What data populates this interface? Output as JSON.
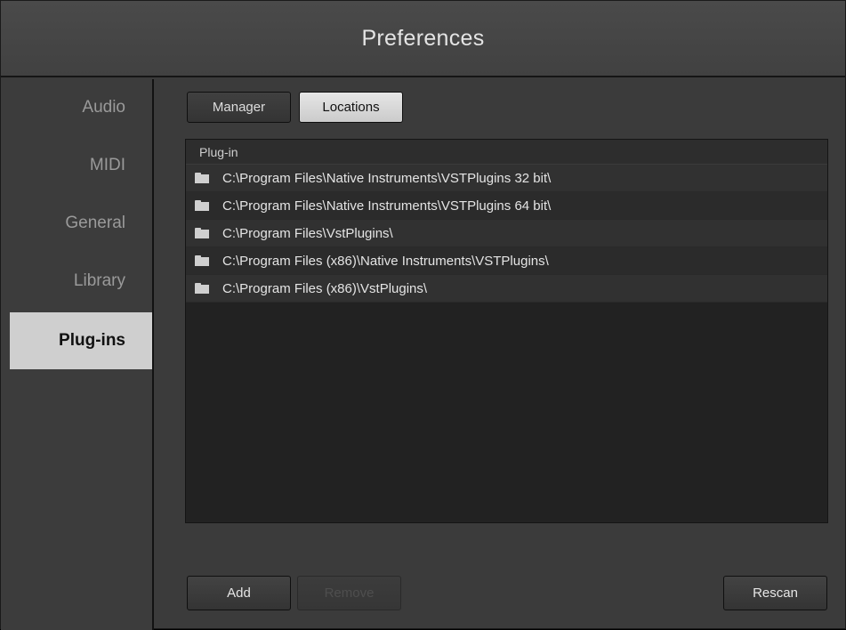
{
  "window": {
    "title": "Preferences"
  },
  "sidebar": {
    "items": [
      {
        "label": "Audio",
        "active": false
      },
      {
        "label": "MIDI",
        "active": false
      },
      {
        "label": "General",
        "active": false
      },
      {
        "label": "Library",
        "active": false
      },
      {
        "label": "Plug-ins",
        "active": true
      }
    ]
  },
  "tabs": [
    {
      "label": "Manager",
      "active": false
    },
    {
      "label": "Locations",
      "active": true
    }
  ],
  "list": {
    "header": "Plug-in",
    "rows": [
      "C:\\Program Files\\Native Instruments\\VSTPlugins 32 bit\\",
      "C:\\Program Files\\Native Instruments\\VSTPlugins 64 bit\\",
      "C:\\Program Files\\VstPlugins\\",
      "C:\\Program Files (x86)\\Native Instruments\\VSTPlugins\\",
      "C:\\Program Files (x86)\\VstPlugins\\"
    ]
  },
  "buttons": {
    "add": "Add",
    "remove": "Remove",
    "rescan": "Rescan"
  },
  "colors": {
    "background": "#3b3b3b",
    "active_tab": "#cfcfcf",
    "list_background": "#222222"
  }
}
